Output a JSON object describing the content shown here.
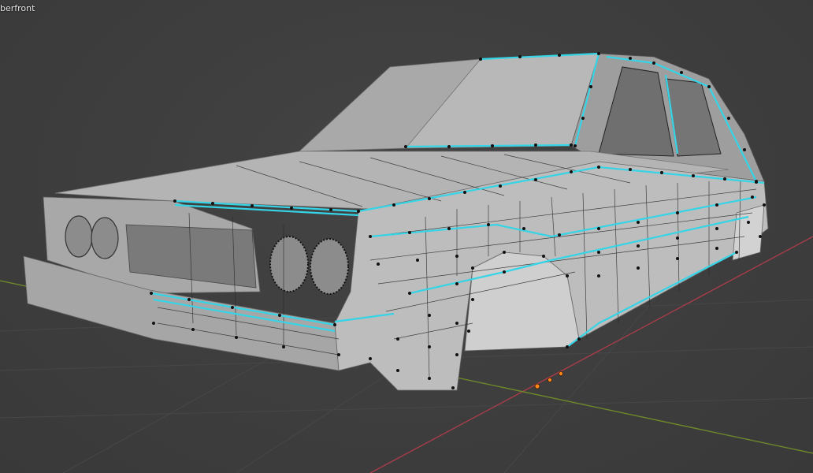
{
  "viewport": {
    "object_name": "berfront",
    "axis_x_color": "#a83c4a",
    "axis_y_color": "#6d8a2a",
    "grid_color": "#474747",
    "mesh_face_color": "#b4b4b4",
    "mesh_shadow_color": "#8e8e8e",
    "vertex_color": "#111111",
    "selected_edge_color": "#35d4e6",
    "origin_color": "#ff8a1a"
  }
}
